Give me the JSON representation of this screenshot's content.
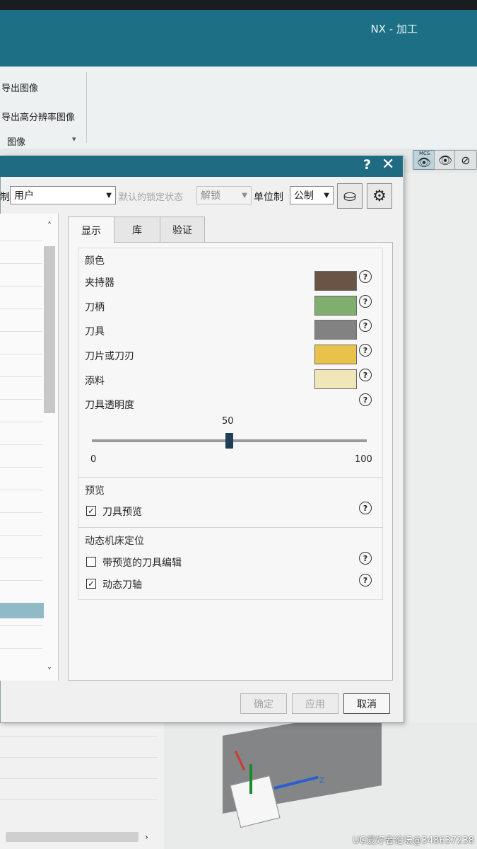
{
  "app": {
    "title": "NX - 加工"
  },
  "ribbon": {
    "export_image": "导出图像",
    "export_hires": "导出高分辨率图像",
    "group": "图像"
  },
  "viewbar": {
    "mcs_label": "MCS"
  },
  "dialog": {
    "help": "?",
    "close": "✕",
    "control_label": "制",
    "control_value": "用户",
    "lock_label": "默认的锁定状态",
    "lock_value": "解锁",
    "unit_label": "单位制",
    "unit_value": "公制",
    "tabs": [
      "显示",
      "库",
      "验证"
    ],
    "colors": {
      "title": "颜色",
      "rows": [
        {
          "label": "夹持器",
          "color": "#6a5446"
        },
        {
          "label": "刀柄",
          "color": "#7fae6e"
        },
        {
          "label": "刀具",
          "color": "#828282"
        },
        {
          "label": "刀片或刀刃",
          "color": "#e8c24a"
        },
        {
          "label": "添料",
          "color": "#f1e6b8"
        }
      ],
      "transparency_label": "刀具透明度",
      "transparency_value": "50",
      "min": "0",
      "max": "100"
    },
    "preview": {
      "title": "预览",
      "tool_preview_label": "刀具预览",
      "tool_preview_checked": true
    },
    "dynamic": {
      "title": "动态机床定位",
      "edit_label": "带预览的刀具编辑",
      "edit_checked": false,
      "axis_label": "动态刀轴",
      "axis_checked": true
    },
    "buttons": {
      "ok": "确定",
      "apply": "应用",
      "cancel": "取消"
    }
  },
  "watermark": "UG爱好者论坛@348637238"
}
